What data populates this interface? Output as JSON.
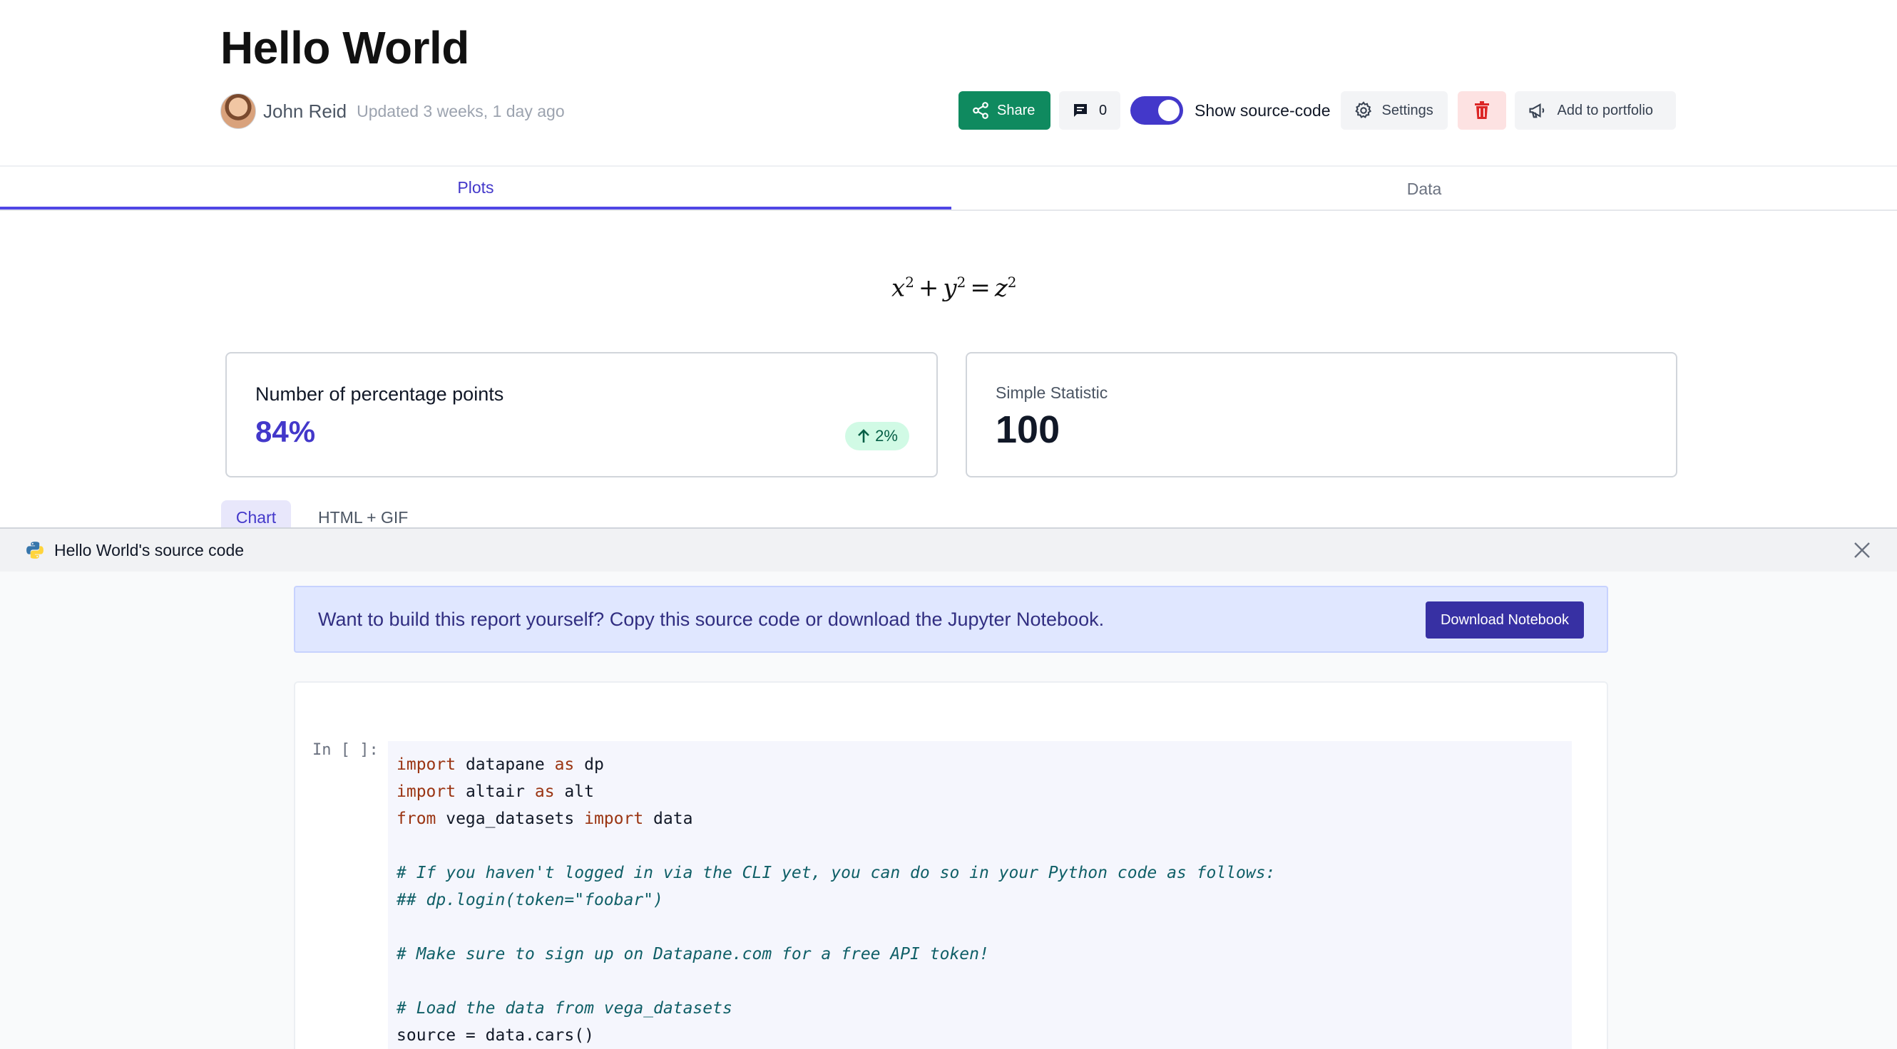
{
  "header": {
    "title": "Hello World",
    "author": "John Reid",
    "updated": "Updated 3 weeks, 1 day ago"
  },
  "actions": {
    "share_label": "Share",
    "comment_count": "0",
    "toggle_label": "Show source-code",
    "toggle_on": true,
    "settings_label": "Settings",
    "portfolio_label": "Add to portfolio",
    "share_color": "#0f8a5f",
    "accent_color": "#4338ca",
    "delete_icon": "trash-icon"
  },
  "tabs": [
    {
      "label": "Plots",
      "active": true
    },
    {
      "label": "Data",
      "active": false
    }
  ],
  "formula": {
    "a": "x",
    "b": "y",
    "c": "z",
    "exp": "2"
  },
  "stats": {
    "card1": {
      "label": "Number of percentage points",
      "value": "84%",
      "change": "2%",
      "direction": "up"
    },
    "card2": {
      "label": "Simple Statistic",
      "value": "100"
    }
  },
  "block_tabs": [
    {
      "label": "Chart",
      "active": true
    },
    {
      "label": "HTML + GIF",
      "active": false
    }
  ],
  "drawer": {
    "title": "Hello World's source code",
    "cta_text": "Want to build this report yourself? Copy this source code or download the Jupyter Notebook.",
    "cta_button": "Download Notebook",
    "prompt": "In [ ]:",
    "code_lines": [
      [
        {
          "t": "import",
          "k": "kw"
        },
        {
          "t": " datapane "
        },
        {
          "t": "as",
          "k": "kw"
        },
        {
          "t": " dp"
        }
      ],
      [
        {
          "t": "import",
          "k": "kw"
        },
        {
          "t": " altair "
        },
        {
          "t": "as",
          "k": "kw"
        },
        {
          "t": " alt"
        }
      ],
      [
        {
          "t": "from",
          "k": "kw"
        },
        {
          "t": " vega_datasets "
        },
        {
          "t": "import",
          "k": "kw"
        },
        {
          "t": " data"
        }
      ],
      [],
      [
        {
          "t": "# If you haven't logged in via the CLI yet, you can do so in your Python code as follows:",
          "k": "cm"
        }
      ],
      [
        {
          "t": "## dp.login(token=\"foobar\")",
          "k": "cm"
        }
      ],
      [],
      [
        {
          "t": "# Make sure to sign up on Datapane.com for a free API token!",
          "k": "cm"
        }
      ],
      [],
      [
        {
          "t": "# Load the data from vega_datasets",
          "k": "cm"
        }
      ],
      [
        {
          "t": "source = data.cars()"
        }
      ]
    ]
  }
}
